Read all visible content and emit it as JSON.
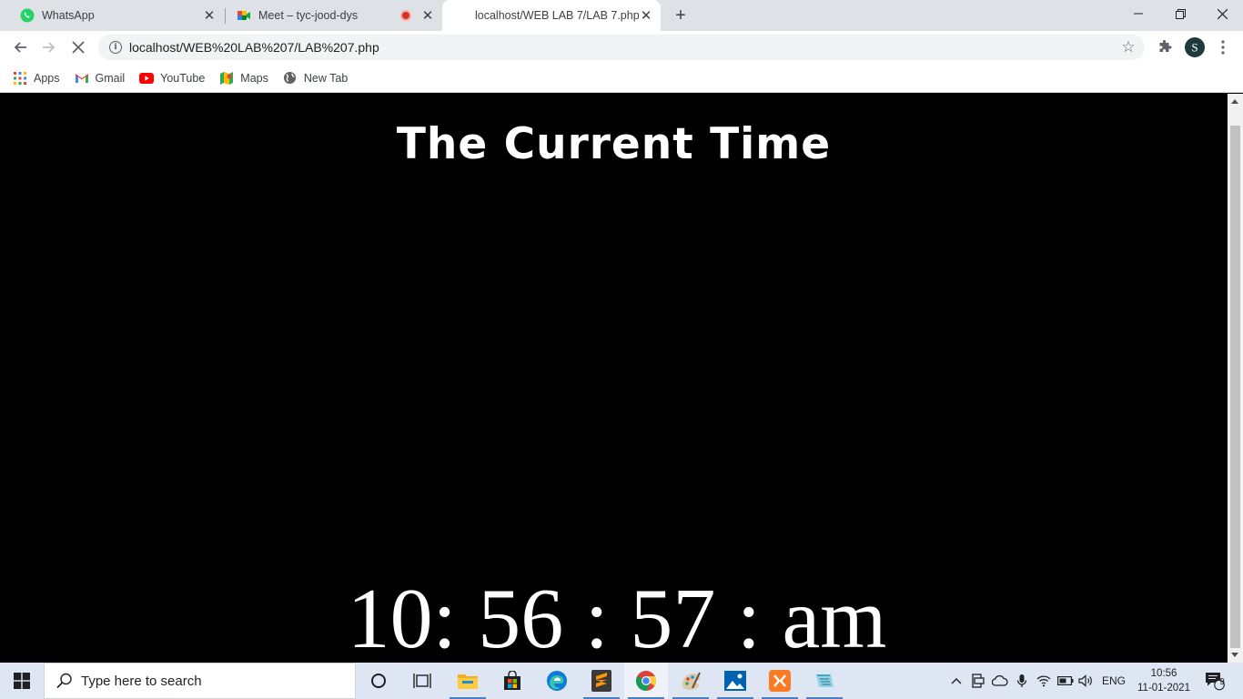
{
  "tabs": [
    {
      "title": "WhatsApp",
      "close": "✕"
    },
    {
      "title": "Meet – tyc-jood-dys",
      "close": "✕"
    },
    {
      "title": "localhost/WEB LAB 7/LAB 7.php",
      "close": "✕"
    }
  ],
  "new_tab": "+",
  "window_controls": {
    "minimize": "—",
    "maximize": "❐",
    "close": "✕"
  },
  "address_bar": {
    "url": "localhost/WEB%20LAB%207/LAB%207.php"
  },
  "bookmarks": [
    {
      "label": "Apps",
      "icon": "apps-grid-icon"
    },
    {
      "label": "Gmail",
      "icon": "gmail-icon"
    },
    {
      "label": "YouTube",
      "icon": "youtube-icon"
    },
    {
      "label": "Maps",
      "icon": "maps-icon"
    },
    {
      "label": "New Tab",
      "icon": "globe-icon"
    }
  ],
  "page": {
    "heading": "The Current Time",
    "clock": "10: 56 : 57 : am"
  },
  "taskbar": {
    "search_placeholder": "Type here to search",
    "language": "ENG",
    "time": "10:56",
    "date": "11-01-2021",
    "notification_count": "9"
  },
  "colors": {
    "page_background": "#000000",
    "page_text": "#ffffff",
    "tabstrip": "#dee1e6",
    "taskbar": "#dde6f2"
  }
}
